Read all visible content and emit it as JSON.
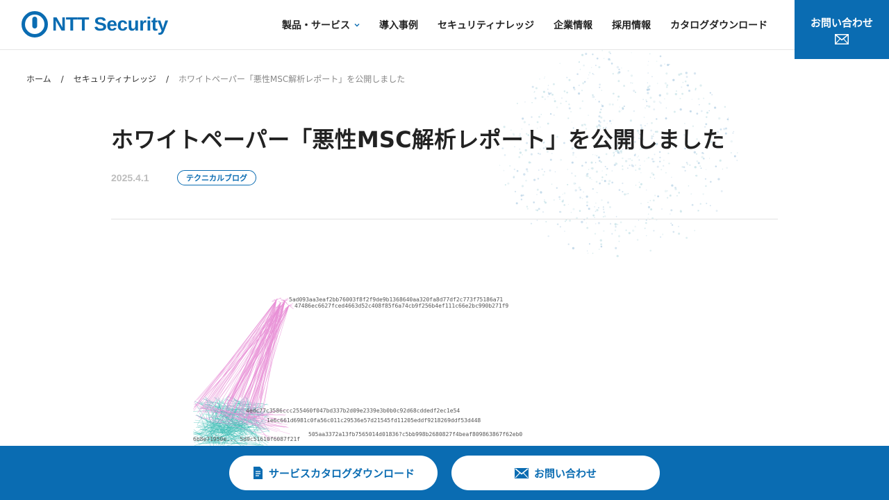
{
  "header": {
    "logo_text": "NTT Security",
    "nav": [
      {
        "label": "製品・サービス",
        "has_dropdown": true
      },
      {
        "label": "導入事例"
      },
      {
        "label": "セキュリティナレッジ"
      },
      {
        "label": "企業情報"
      },
      {
        "label": "採用情報"
      },
      {
        "label": "カタログダウンロード"
      }
    ],
    "contact_label": "お問い合わせ"
  },
  "breadcrumb": {
    "home": "ホーム",
    "section": "セキュリティナレッジ",
    "current": "ホワイトペーパー「悪性MSC解析レポート」を公開しました",
    "separator": "/"
  },
  "article": {
    "title": "ホワイトペーパー「悪性MSC解析レポート」を公開しました",
    "date": "2025.4.1",
    "tag": "テクニカルブログ"
  },
  "graph_labels": [
    "5ad093aa3eaf2bb76003f8f2f9de9b1368640aa320fa8d77df2c773f75186a71",
    "47486ec6627fced4663d52c408f85f6a74cb9f256b4ef111c66e2bc990b271f9",
    "4edc77c3586ccc255460f047bd337b2d09e2339e3b0b0c92d68cddedf2ec1e54",
    "1e6c661d6981c0fa56c011c29536e57d21545fd11205eddf9218269ddf53d448",
    "505aa3372a13fb7565014d01836?c5bb998b2680827f4beaf809863867f62eb0",
    "6b8e71950e... 5d9c51610f6087f21f"
  ],
  "footer": {
    "catalog_label": "サービスカタログダウンロード",
    "contact_label": "お問い合わせ"
  },
  "colors": {
    "brand": "#0a6cb2",
    "edge_pink": "#e88fd6",
    "edge_teal": "#3dbdb5"
  }
}
